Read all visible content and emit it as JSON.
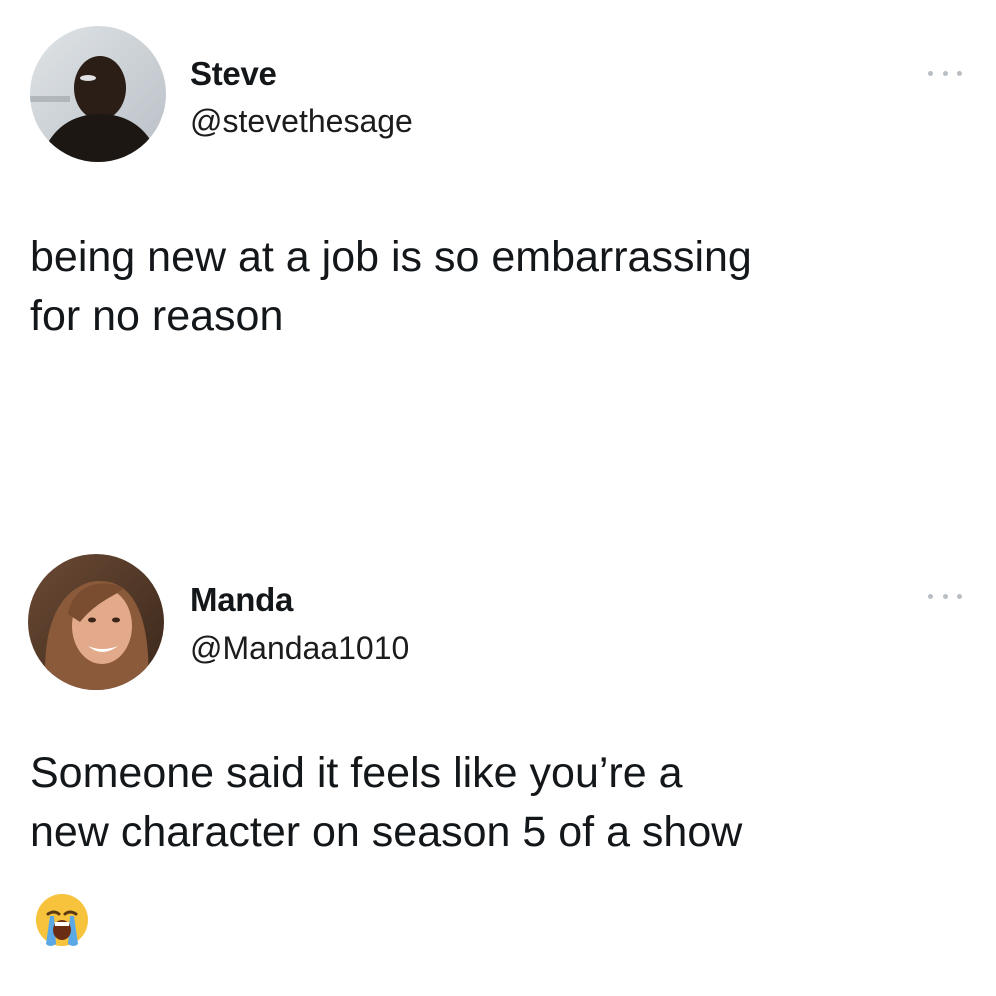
{
  "tweets": [
    {
      "display_name": "Steve",
      "handle": "@stevethesage",
      "avatar_icon": "avatar-photo-steve",
      "more_icon": "more-options-icon",
      "text_lines": [
        "being new at a job is so embarrassing",
        "for no reason"
      ]
    },
    {
      "display_name": "Manda",
      "handle": "@Mandaa1010",
      "avatar_icon": "avatar-photo-manda",
      "more_icon": "more-options-icon",
      "text_lines": [
        "Someone said it feels like you’re a",
        "new character on season 5 of a show"
      ],
      "emoji": "loudly-crying-face-icon"
    }
  ],
  "colors": {
    "background": "#ffffff",
    "text": "#14171a",
    "more_dots": "#b9bec3",
    "emoji_face": "#f7c23c",
    "emoji_tears": "#5aa9e6"
  }
}
